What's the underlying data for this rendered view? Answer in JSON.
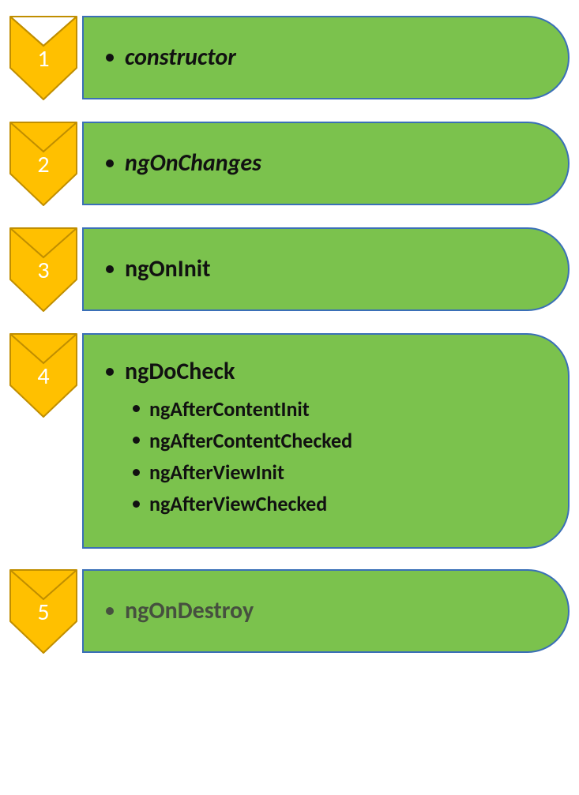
{
  "colors": {
    "chevron_fill": "#ffc000",
    "chevron_stroke": "#c08e00",
    "card_bg": "#7bc24d",
    "card_border": "#3a6fb7",
    "number_text": "#ffffff",
    "item_text": "#111111",
    "dim_text": "#3d3d3d"
  },
  "steps": [
    {
      "number": "1",
      "main": "constructor",
      "italic": true,
      "dim": false,
      "sub": []
    },
    {
      "number": "2",
      "main": "ngOnChanges",
      "italic": true,
      "dim": false,
      "sub": []
    },
    {
      "number": "3",
      "main": "ngOnInit",
      "italic": false,
      "dim": false,
      "sub": []
    },
    {
      "number": "4",
      "main": "ngDoCheck",
      "italic": false,
      "dim": false,
      "sub": [
        "ngAfterContentInit",
        "ngAfterContentChecked",
        "ngAfterViewInit",
        "ngAfterViewChecked"
      ]
    },
    {
      "number": "5",
      "main": "ngOnDestroy",
      "italic": false,
      "dim": true,
      "sub": []
    }
  ]
}
